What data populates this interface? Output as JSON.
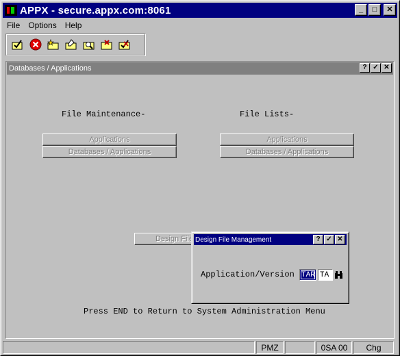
{
  "window": {
    "title": "APPX - secure.appx.com:8061",
    "minimize_glyph": "_",
    "maximize_glyph": "□",
    "close_glyph": "✕"
  },
  "menu": {
    "items": [
      "File",
      "Options",
      "Help"
    ]
  },
  "toolbar": {
    "icons": [
      "check-folder-icon",
      "stop-icon",
      "star-folder-icon",
      "edit-folder-icon",
      "search-folder-icon",
      "delete-folder-icon",
      "check-delete-folder-icon"
    ]
  },
  "child_window": {
    "title": "Databases / Applications",
    "help_glyph": "?",
    "ok_glyph": "✓",
    "close_glyph": "✕",
    "file_maintenance_heading": "File Maintenance-",
    "file_lists_heading": "File Lists-",
    "maintenance_buttons": [
      "Applications",
      "Databases / Applications"
    ],
    "list_buttons": [
      "Applications",
      "Databases / Applications"
    ],
    "design_button_label": "Design File",
    "footer_text": "Press END to Return to System Administration Menu"
  },
  "dialog": {
    "title": "Design File Management",
    "help_glyph": "?",
    "ok_glyph": "✓",
    "close_glyph": "✕",
    "field_label": "Application/Version",
    "application_value": "TAR",
    "version_value": "TA"
  },
  "statusbar": {
    "panels": [
      "",
      "PMZ",
      "",
      "0SA 00",
      "Chg"
    ]
  },
  "colors": {
    "title_active": "#000080",
    "title_inactive": "#808080",
    "face": "#c0c0c0"
  }
}
